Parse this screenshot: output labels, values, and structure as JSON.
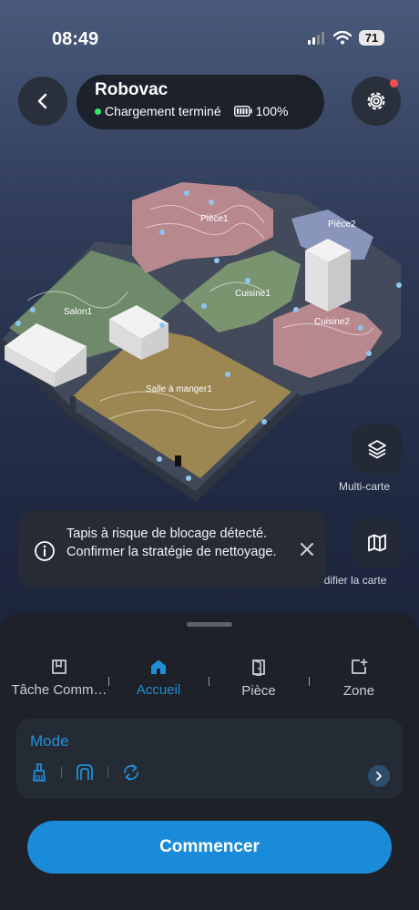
{
  "status": {
    "time": "08:49",
    "battery": "71"
  },
  "device": {
    "name": "Robovac",
    "state": "Chargement terminé",
    "battery_level": "100%"
  },
  "map": {
    "rooms": {
      "piece1": "Pièce1",
      "piece2": "Pièce2",
      "cuisine1": "Cuisine1",
      "cuisine2": "Cuisine2",
      "salon": "Salon1",
      "salle_a_manger": "Salle à manger1"
    }
  },
  "tools": {
    "multi_map": "Multi-carte",
    "edit_map": "Modifier la carte"
  },
  "alert": {
    "text": "Tapis à risque de blocage détecté. Confirmer la stratégie de nettoyage."
  },
  "tabs": [
    {
      "label": "Tâche Comm…",
      "icon": "task-book-icon"
    },
    {
      "label": "Accueil",
      "icon": "home-icon"
    },
    {
      "label": "Pièce",
      "icon": "door-icon"
    },
    {
      "label": "Zone",
      "icon": "zone-add-icon"
    }
  ],
  "mode": {
    "title": "Mode"
  },
  "actions": {
    "start": "Commencer"
  },
  "colors": {
    "accent": "#1a8bd9",
    "status_dot": "#2ee86c",
    "notify": "#ff4a4a"
  }
}
